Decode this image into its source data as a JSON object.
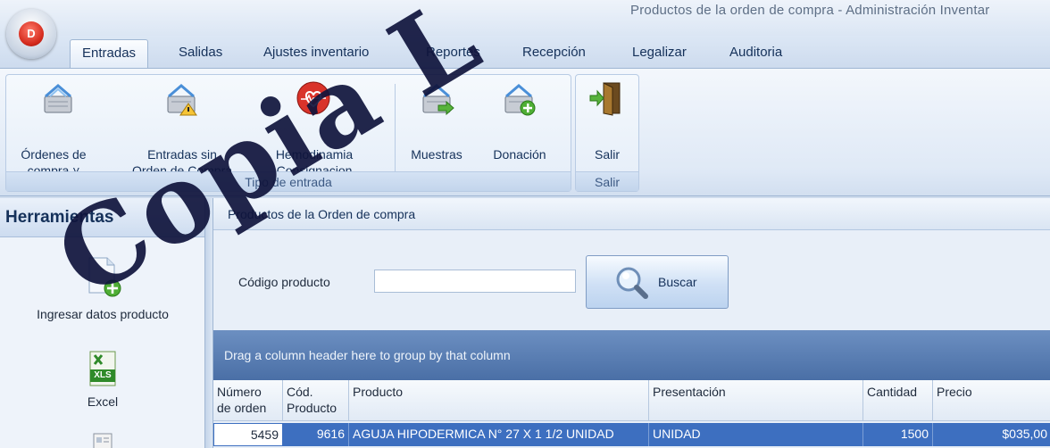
{
  "window": {
    "title": "Productos de la orden de compra - Administración Inventar"
  },
  "app_button": {
    "label": "D"
  },
  "tabs": [
    {
      "label": "Entradas",
      "active": true
    },
    {
      "label": "Salidas"
    },
    {
      "label": "Ajustes inventario"
    },
    {
      "label": "Reportes"
    },
    {
      "label": "Recepción"
    },
    {
      "label": "Legalizar"
    },
    {
      "label": "Auditoria"
    }
  ],
  "ribbon": {
    "group_tipo": {
      "label": "Tipo de entrada",
      "buttons": [
        {
          "line1": "Órdenes de",
          "line2": "compra ˅",
          "icon": "basket-icon"
        },
        {
          "line1": "Entradas sin",
          "line2": "Orden de Compra",
          "icon": "basket-warning-icon"
        },
        {
          "line1": "Hemodinamia",
          "line2": "Consignacion",
          "icon": "heart-pulse-icon"
        },
        {
          "line1": "Muestras",
          "line2": "",
          "icon": "basket-arrow-icon"
        },
        {
          "line1": "Donación",
          "line2": "",
          "icon": "basket-add-icon"
        }
      ]
    },
    "group_salir": {
      "label": "Salir",
      "buttons": [
        {
          "line1": "Salir",
          "line2": "",
          "icon": "exit-door-icon"
        }
      ]
    }
  },
  "sidebar": {
    "title": "Herramientas",
    "items": [
      {
        "label": "Ingresar datos producto",
        "icon": "add-document-icon"
      },
      {
        "label": "Excel",
        "icon": "excel-icon",
        "icon_text": "XLS"
      },
      {
        "label": "",
        "icon": "report-icon"
      }
    ]
  },
  "panel": {
    "title": "Productos de la Orden de compra",
    "codigo_label": "Código producto",
    "codigo_value": "",
    "search_button": "Buscar"
  },
  "grid": {
    "group_hint": "Drag a column header here to group by that column",
    "columns": [
      {
        "line1": "Número",
        "line2": "de orden"
      },
      {
        "line1": "Cód.",
        "line2": "Producto"
      },
      {
        "line1": "Producto",
        "line2": ""
      },
      {
        "line1": "Presentación",
        "line2": ""
      },
      {
        "line1": "Cantidad",
        "line2": ""
      },
      {
        "line1": "Precio",
        "line2": ""
      }
    ],
    "rows": [
      [
        "5459",
        "9616",
        "AGUJA HIPODERMICA N° 27 X 1 1/2  UNIDAD",
        "UNIDAD",
        "1500",
        "$035,00"
      ]
    ]
  },
  "watermark": {
    "text": "Copia L"
  },
  "colors": {
    "accent": "#3d6fc0",
    "ribbon": "#dfe9f6",
    "group_area": "#4a6fa6"
  }
}
